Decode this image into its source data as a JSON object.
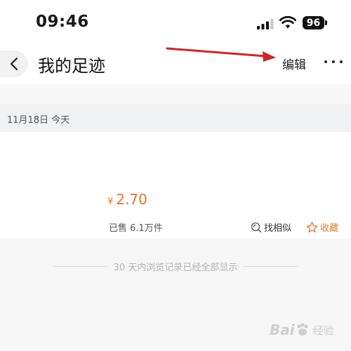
{
  "status_bar": {
    "time": "09:46",
    "battery": "96"
  },
  "nav": {
    "title": "我的足迹",
    "edit_label": "编辑"
  },
  "date_header": {
    "label": "11月18日 今天"
  },
  "product": {
    "currency": "¥",
    "price": "2.70",
    "sold": "已售 6.1万件",
    "find_similar": "找相似",
    "favorite": "收藏"
  },
  "footer": {
    "note": "30 天内浏览记录已经全部显示"
  },
  "watermark": {
    "logo": "Bai",
    "sub": "经验"
  },
  "colors": {
    "accent": "#e8742c",
    "annotation": "#c8282a"
  }
}
